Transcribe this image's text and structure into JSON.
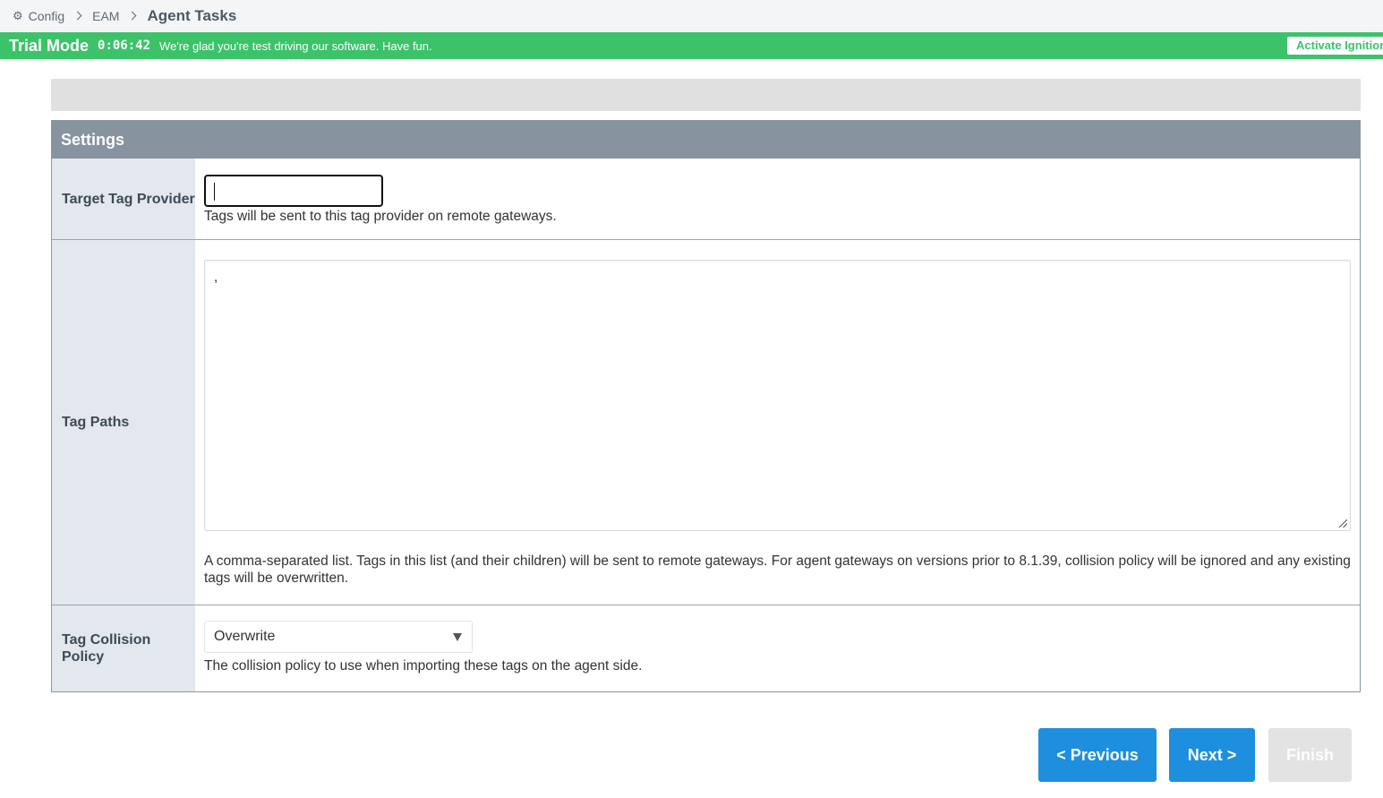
{
  "breadcrumb": {
    "icon": "gear-icon",
    "items": [
      "Config",
      "EAM"
    ],
    "current": "Agent Tasks"
  },
  "trial": {
    "mode": "Trial Mode",
    "timer": "0:06:42",
    "message": "We're glad you're test driving our software. Have fun.",
    "activate": "Activate Ignition"
  },
  "settings": {
    "title": "Settings",
    "target_tag_provider": {
      "label": "Target Tag Provider",
      "value": "",
      "description": "Tags will be sent to this tag provider on remote gateways."
    },
    "tag_paths": {
      "label": "Tag Paths",
      "value": ",",
      "description": "A comma-separated list. Tags in this list (and their children) will be sent to remote gateways. For agent gateways on versions prior to 8.1.39, collision policy will be ignored and any existing tags will be overwritten."
    },
    "tag_collision_policy": {
      "label": "Tag Collision Policy",
      "selected": "Overwrite",
      "description": "The collision policy to use when importing these tags on the agent side."
    }
  },
  "buttons": {
    "previous": "< Previous",
    "next": "Next >",
    "finish": "Finish"
  },
  "colors": {
    "trial_green": "#3cc36a",
    "primary_blue": "#1e8fdf",
    "header_grey": "#87939e"
  }
}
